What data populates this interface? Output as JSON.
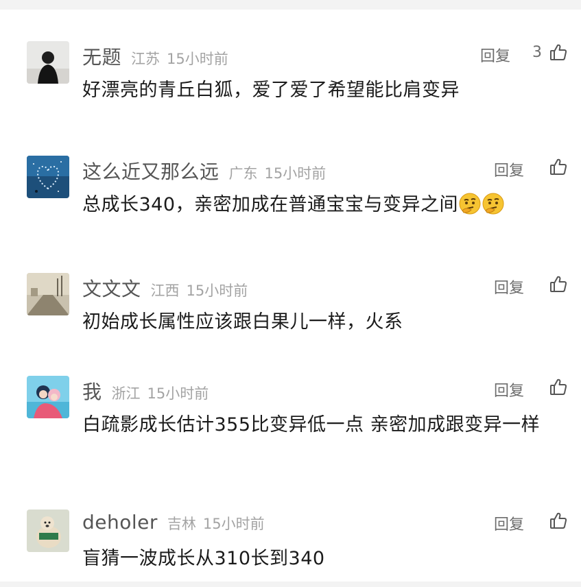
{
  "comments": [
    {
      "username": "无题",
      "location": "江苏",
      "time": "15小时前",
      "text": "好漂亮的青丘白狐，爱了爱了希望能比肩变异",
      "reply_label": "回复",
      "like_count": "3",
      "avatar": "person-back-photo"
    },
    {
      "username": "这么近又那么远",
      "location": "广东",
      "time": "15小时前",
      "text": "总成长340，亲密加成在普通宝宝与变异之间",
      "reply_label": "回复",
      "like_count": "",
      "avatar": "heart-stars-photo",
      "emojis": [
        "thinking-emoji",
        "thinking-emoji"
      ]
    },
    {
      "username": "文文文",
      "location": "江西",
      "time": "15小时前",
      "text": "初始成长属性应该跟白果儿一样，火系",
      "reply_label": "回复",
      "like_count": "",
      "avatar": "foggy-road-photo"
    },
    {
      "username": "我",
      "location": "浙江",
      "time": "15小时前",
      "text": "白疏影成长估计355比变异低一点 亲密加成跟变异一样",
      "reply_label": "回复",
      "like_count": "",
      "avatar": "anime-couple-photo"
    },
    {
      "username": "deholer",
      "location": "吉林",
      "time": "15小时前",
      "text": "盲猜一波成长从310长到340",
      "reply_label": "回复",
      "like_count": "",
      "avatar": "dog-photo"
    }
  ],
  "colors": {
    "username": "#555555",
    "meta": "#a3a3a3",
    "text": "#1b1b1b",
    "action": "#6c6c6c"
  },
  "icons": {
    "like": "thumbs-up-outline-icon",
    "emoji": "thinking-face-emoji"
  }
}
